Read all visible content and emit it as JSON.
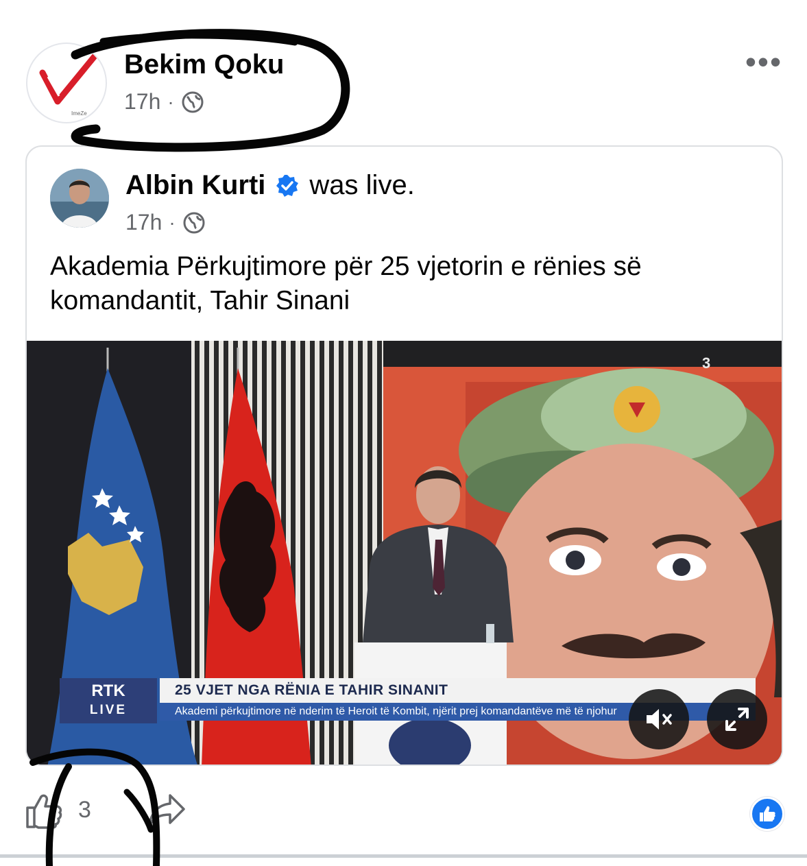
{
  "post": {
    "sharer_name": "Bekim Qoku",
    "time": "17h",
    "separator": "·",
    "audience_icon": "globe-icon",
    "more_icon": "more-options-icon",
    "more_glyph": "•••",
    "avatar_caption": "ImeZe"
  },
  "shared": {
    "author_name": "Albin Kurti",
    "verified_icon": "verified-badge-icon",
    "status": "was live.",
    "time": "17h",
    "separator": "·",
    "text": "Akademia Përkujtimore për 25 vjetorin e rënies së komandantit, Tahir Sinani"
  },
  "video": {
    "channel_line1": "RTK",
    "channel_line2": "LIVE",
    "headline": "25 VJET NGA RËNIA E TAHIR SINANIT",
    "ticker": "Akademi përkujtimore në nderim të Heroit të Kombit, njërit prej komandantëve më të njohur",
    "corner_mark": "3",
    "mute_icon": "mute-icon",
    "fullscreen_icon": "fullscreen-icon"
  },
  "actions": {
    "like_icon": "like-icon",
    "like_count": "3",
    "share_icon": "share-icon",
    "reaction_icon": "like-reaction-icon"
  },
  "colors": {
    "link_blue": "#1877f2",
    "meta_gray": "#65676b",
    "rtk_navy": "#2d3f78",
    "ticker_blue": "#2f5aa8",
    "albania_red": "#d8231c",
    "kosovo_blue": "#2a5aa4"
  }
}
